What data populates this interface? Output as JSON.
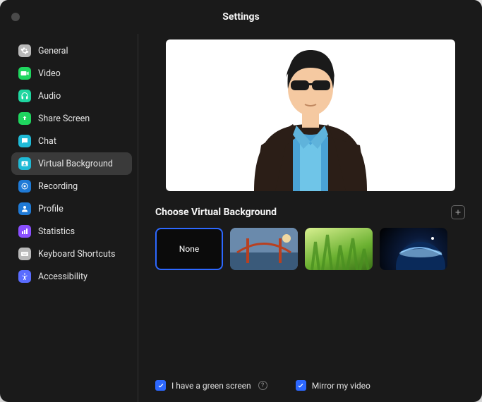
{
  "window": {
    "title": "Settings"
  },
  "sidebar": {
    "items": [
      {
        "label": "General",
        "color": "#b8b8b8"
      },
      {
        "label": "Video",
        "color": "#1fd65f"
      },
      {
        "label": "Audio",
        "color": "#1fd6a0"
      },
      {
        "label": "Share Screen",
        "color": "#1fd65f"
      },
      {
        "label": "Chat",
        "color": "#1fbad6"
      },
      {
        "label": "Virtual Background",
        "color": "#1fbad6"
      },
      {
        "label": "Recording",
        "color": "#1f7ad6"
      },
      {
        "label": "Profile",
        "color": "#1f7ad6"
      },
      {
        "label": "Statistics",
        "color": "#8a4fff"
      },
      {
        "label": "Keyboard Shortcuts",
        "color": "#b8b8b8"
      },
      {
        "label": "Accessibility",
        "color": "#5a6cff"
      }
    ],
    "active_index": 5
  },
  "section": {
    "title": "Choose Virtual Background",
    "thumbs": [
      {
        "label": "None"
      },
      {
        "label": ""
      },
      {
        "label": ""
      },
      {
        "label": ""
      }
    ],
    "selected_index": 0
  },
  "options": {
    "green_screen": {
      "label": "I have a green screen",
      "checked": true
    },
    "mirror": {
      "label": "Mirror my video",
      "checked": true
    }
  }
}
